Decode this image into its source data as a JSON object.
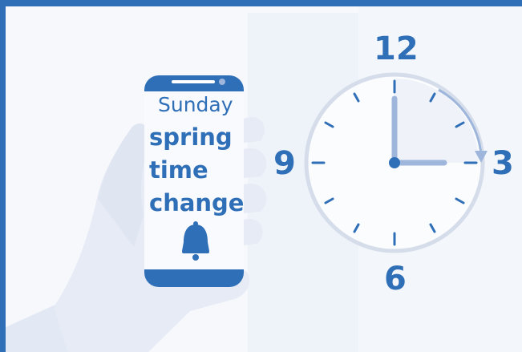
{
  "phone": {
    "day": "Sunday",
    "message_line1": "spring",
    "message_line2": "time",
    "message_line3": "change",
    "icon": "bell-icon"
  },
  "clock": {
    "numeral_12": "12",
    "numeral_3": "3",
    "numeral_6": "6",
    "numeral_9": "9",
    "time_shown": "3:00",
    "hour_hand_points_to": "3",
    "minute_hand_points_to": "12",
    "arrow": "clockwise-arrow"
  },
  "colors": {
    "frame": "#2f6fb7",
    "brand_blue": "#2f6fb7",
    "light_blue": "#9fb6dc",
    "hand_skin": "#e6ebf5",
    "background": "#f6f8fc"
  }
}
